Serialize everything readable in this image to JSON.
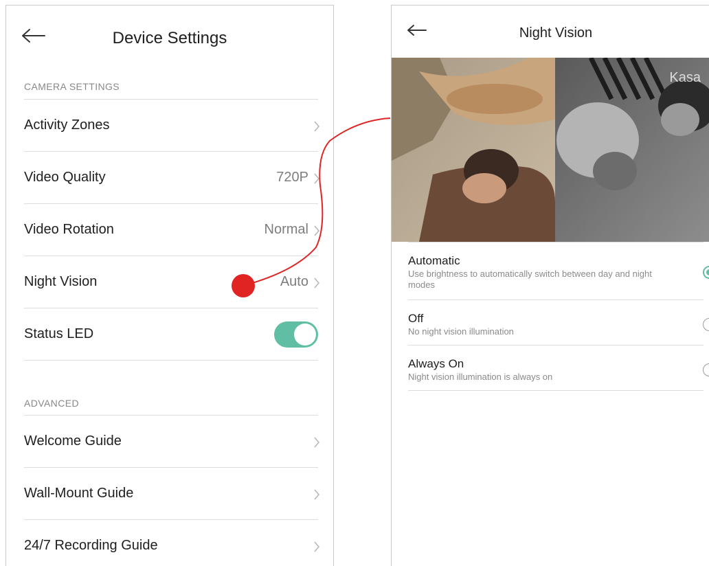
{
  "colors": {
    "accent": "#5fbea3",
    "annotation": "#e02424",
    "divider": "#dcdcdc",
    "muted_text": "#888888"
  },
  "device_settings": {
    "title": "Device Settings",
    "back_icon": "arrow-left-icon",
    "camera_section": {
      "label": "CAMERA SETTINGS",
      "rows": [
        {
          "label": "Activity Zones",
          "value": ""
        },
        {
          "label": "Video Quality",
          "value": "720P"
        },
        {
          "label": "Video Rotation",
          "value": "Normal"
        },
        {
          "label": "Night Vision",
          "value": "Auto"
        }
      ],
      "status_led": {
        "label": "Status LED",
        "enabled": true
      }
    },
    "advanced_section": {
      "label": "ADVANCED",
      "rows": [
        {
          "label": "Welcome Guide"
        },
        {
          "label": "Wall-Mount Guide"
        },
        {
          "label": "24/7 Recording Guide"
        }
      ]
    }
  },
  "night_vision": {
    "title": "Night Vision",
    "back_icon": "arrow-left-icon",
    "photo_watermark": "Kasa",
    "options": [
      {
        "title": "Automatic",
        "description": "Use brightness to automatically switch between day and night modes",
        "selected": true
      },
      {
        "title": "Off",
        "description": "No night vision illumination",
        "selected": false
      },
      {
        "title": "Always On",
        "description": "Night vision illumination is always on",
        "selected": false
      }
    ]
  }
}
